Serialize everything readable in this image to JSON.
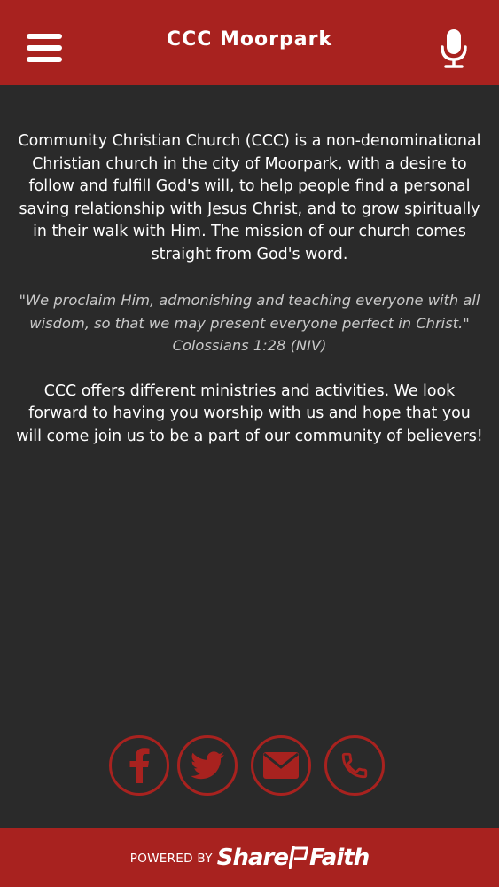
{
  "colors": {
    "accent": "#a8221f",
    "background": "#2a2a2a",
    "text": "#ffffff",
    "quote_text": "#c9c9c9"
  },
  "header": {
    "title": "CCC Moorpark",
    "menu_icon": "hamburger-menu-icon",
    "mic_icon": "microphone-icon"
  },
  "content": {
    "paragraph1": "Community Christian Church (CCC) is a non-denominational Christian church in the city of Moorpark, with a desire to follow and fulfill God's will, to help people find a personal saving relationship with Jesus Christ, and to grow spiritually in their walk with Him. The mission of our church comes straight from God's word.",
    "quote": "\"We proclaim Him, admonishing and teaching everyone with all wisdom, so that we may present everyone perfect in Christ.\"",
    "quote_reference": "Colossians 1:28 (NIV)",
    "paragraph2": "CCC offers different ministries and activities. We look forward to having you worship with us and hope that you will come join us to be a part of our community of believers!"
  },
  "social": [
    {
      "icon": "facebook-icon"
    },
    {
      "icon": "twitter-icon"
    },
    {
      "icon": "email-icon"
    },
    {
      "icon": "phone-icon"
    }
  ],
  "footer": {
    "powered_by": "POWERED BY",
    "brand_left": "Share",
    "brand_right": "Faith",
    "brand_icon": "sharefaith-flag-icon"
  }
}
